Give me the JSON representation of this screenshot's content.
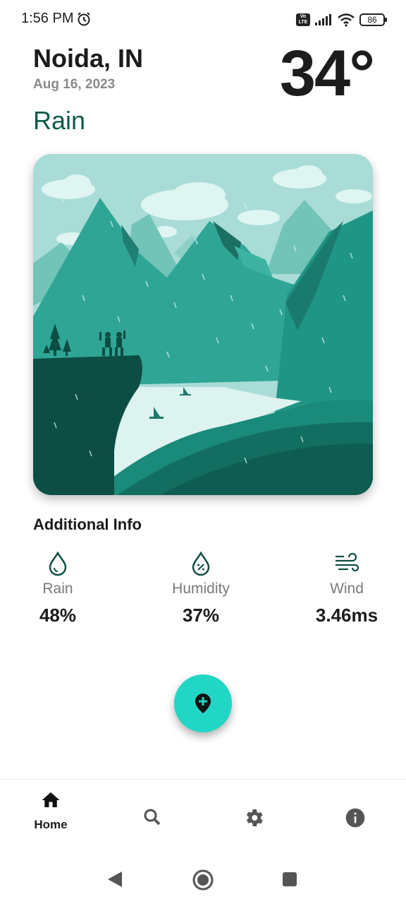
{
  "status": {
    "time": "1:56 PM",
    "network_badge": "Vo LTE",
    "battery": "86",
    "icons": [
      "alarm-icon",
      "volte-icon",
      "signal-icon",
      "wifi-icon",
      "battery-icon"
    ]
  },
  "weather": {
    "city": "Noida, IN",
    "date": "Aug 16, 2023",
    "temperature": "34°",
    "condition": "Rain"
  },
  "additional_info": {
    "title": "Additional Info",
    "items": [
      {
        "label": "Rain",
        "value": "48%",
        "icon": "raindrop-icon"
      },
      {
        "label": "Humidity",
        "value": "37%",
        "icon": "humidity-icon"
      },
      {
        "label": "Wind",
        "value": "3.46ms",
        "icon": "wind-icon"
      }
    ]
  },
  "fab": {
    "icon": "add-location-icon"
  },
  "nav": {
    "items": [
      {
        "label": "Home",
        "icon": "home-icon",
        "active": true
      },
      {
        "label": "",
        "icon": "search-icon",
        "active": false
      },
      {
        "label": "",
        "icon": "settings-icon",
        "active": false
      },
      {
        "label": "",
        "icon": "info-icon",
        "active": false
      }
    ]
  },
  "colors": {
    "accent": "#21d6c4",
    "condition_text": "#0e5a4a",
    "sky": "#a9dcd6",
    "mountain": "#2a9d8f",
    "dark_green": "#0b5346"
  }
}
